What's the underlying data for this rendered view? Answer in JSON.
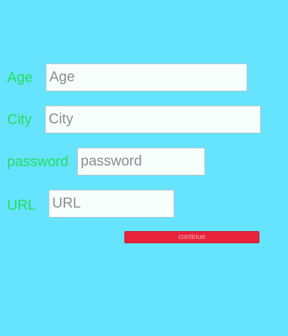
{
  "form": {
    "age": {
      "label": "Age",
      "placeholder": "Age",
      "value": ""
    },
    "city": {
      "label": "City",
      "placeholder": "City",
      "value": ""
    },
    "password": {
      "label": "password",
      "placeholder": "password",
      "value": ""
    },
    "url": {
      "label": "URL",
      "placeholder": "URL",
      "value": ""
    },
    "continue_label": "continue"
  },
  "colors": {
    "background": "#66e3ff",
    "label": "#1fdf5a",
    "button": "#e8233a"
  }
}
